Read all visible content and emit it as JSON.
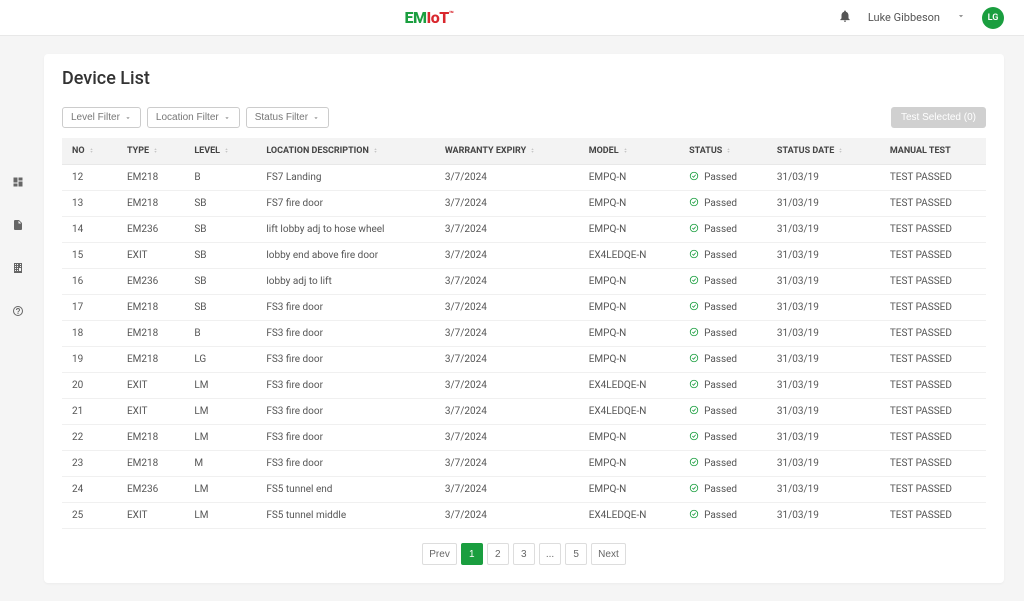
{
  "header": {
    "logo_em": "EM",
    "logo_io": "IoT",
    "user_name": "Luke Gibbeson",
    "user_initials": "LG"
  },
  "page": {
    "title": "Device List"
  },
  "filters": {
    "level": "Level Filter",
    "location": "Location Filter",
    "status": "Status Filter",
    "test_selected": "Test Selected (0)"
  },
  "columns": {
    "no": "NO",
    "type": "TYPE",
    "level": "LEVEL",
    "location": "LOCATION DESCRIPTION",
    "warranty": "WARRANTY EXPIRY",
    "model": "MODEL",
    "status": "STATUS",
    "status_date": "STATUS DATE",
    "manual_test": "MANUAL TEST"
  },
  "rows": [
    {
      "no": "12",
      "type": "EM218",
      "level": "B",
      "location": "FS7 Landing",
      "warranty": "3/7/2024",
      "model": "EMPQ-N",
      "status": "Passed",
      "status_date": "31/03/19",
      "manual_test": "TEST PASSED"
    },
    {
      "no": "13",
      "type": "EM218",
      "level": "SB",
      "location": "FS7 fire door",
      "warranty": "3/7/2024",
      "model": "EMPQ-N",
      "status": "Passed",
      "status_date": "31/03/19",
      "manual_test": "TEST PASSED"
    },
    {
      "no": "14",
      "type": "EM236",
      "level": "SB",
      "location": "lift lobby adj to hose wheel",
      "warranty": "3/7/2024",
      "model": "EMPQ-N",
      "status": "Passed",
      "status_date": "31/03/19",
      "manual_test": "TEST PASSED"
    },
    {
      "no": "15",
      "type": "EXIT",
      "level": "SB",
      "location": "lobby end above fire door",
      "warranty": "3/7/2024",
      "model": "EX4LEDQE-N",
      "status": "Passed",
      "status_date": "31/03/19",
      "manual_test": "TEST PASSED"
    },
    {
      "no": "16",
      "type": "EM236",
      "level": "SB",
      "location": "lobby adj to lift",
      "warranty": "3/7/2024",
      "model": "EMPQ-N",
      "status": "Passed",
      "status_date": "31/03/19",
      "manual_test": "TEST PASSED"
    },
    {
      "no": "17",
      "type": "EM218",
      "level": "SB",
      "location": "FS3 fire door",
      "warranty": "3/7/2024",
      "model": "EMPQ-N",
      "status": "Passed",
      "status_date": "31/03/19",
      "manual_test": "TEST PASSED"
    },
    {
      "no": "18",
      "type": "EM218",
      "level": "B",
      "location": "FS3 fire door",
      "warranty": "3/7/2024",
      "model": "EMPQ-N",
      "status": "Passed",
      "status_date": "31/03/19",
      "manual_test": "TEST PASSED"
    },
    {
      "no": "19",
      "type": "EM218",
      "level": "LG",
      "location": "FS3 fire door",
      "warranty": "3/7/2024",
      "model": "EMPQ-N",
      "status": "Passed",
      "status_date": "31/03/19",
      "manual_test": "TEST PASSED"
    },
    {
      "no": "20",
      "type": "EXIT",
      "level": "LM",
      "location": "FS3 fire door",
      "warranty": "3/7/2024",
      "model": "EX4LEDQE-N",
      "status": "Passed",
      "status_date": "31/03/19",
      "manual_test": "TEST PASSED"
    },
    {
      "no": "21",
      "type": "EXIT",
      "level": "LM",
      "location": "FS3 fire door",
      "warranty": "3/7/2024",
      "model": "EX4LEDQE-N",
      "status": "Passed",
      "status_date": "31/03/19",
      "manual_test": "TEST PASSED"
    },
    {
      "no": "22",
      "type": "EM218",
      "level": "LM",
      "location": "FS3 fire door",
      "warranty": "3/7/2024",
      "model": "EMPQ-N",
      "status": "Passed",
      "status_date": "31/03/19",
      "manual_test": "TEST PASSED"
    },
    {
      "no": "23",
      "type": "EM218",
      "level": "M",
      "location": "FS3 fire door",
      "warranty": "3/7/2024",
      "model": "EMPQ-N",
      "status": "Passed",
      "status_date": "31/03/19",
      "manual_test": "TEST PASSED"
    },
    {
      "no": "24",
      "type": "EM236",
      "level": "LM",
      "location": "FS5 tunnel end",
      "warranty": "3/7/2024",
      "model": "EMPQ-N",
      "status": "Passed",
      "status_date": "31/03/19",
      "manual_test": "TEST PASSED"
    },
    {
      "no": "25",
      "type": "EXIT",
      "level": "LM",
      "location": "FS5 tunnel middle",
      "warranty": "3/7/2024",
      "model": "EX4LEDQE-N",
      "status": "Passed",
      "status_date": "31/03/19",
      "manual_test": "TEST PASSED"
    }
  ],
  "pagination": {
    "prev": "Prev",
    "next": "Next",
    "pages": [
      "1",
      "2",
      "3",
      "...",
      "5"
    ],
    "active": "1"
  }
}
